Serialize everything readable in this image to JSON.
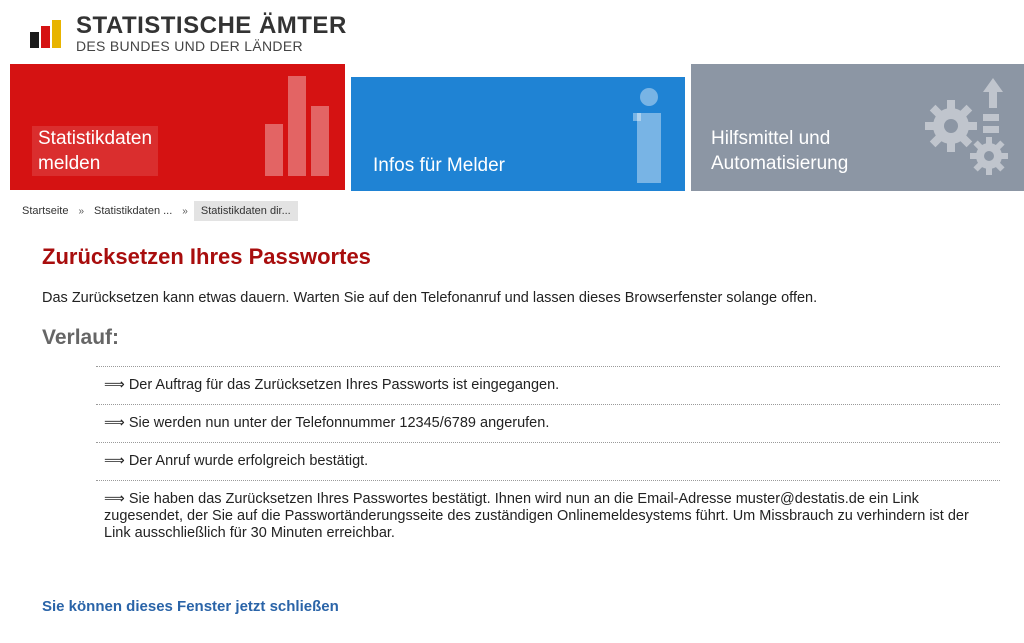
{
  "header": {
    "logo_title": "STATISTISCHE ÄMTER",
    "logo_subtitle": "DES BUNDES UND DER LÄNDER"
  },
  "tiles": [
    {
      "label": "Statistikdaten\nmelden",
      "color": "#d51212",
      "icon": "bar-chart-icon"
    },
    {
      "label": "Infos für Melder",
      "color": "#1f83d4",
      "icon": "info-icon"
    },
    {
      "label": "Hilfsmittel und\nAutomatisierung",
      "color": "#8c96a4",
      "icon": "gears-icon"
    }
  ],
  "breadcrumb": [
    {
      "label": "Startseite"
    },
    {
      "label": "Statistikdaten ..."
    },
    {
      "label": "Statistikdaten dir..."
    }
  ],
  "main": {
    "title": "Zurücksetzen Ihres Passwortes",
    "intro": "Das Zurücksetzen kann etwas dauern. Warten Sie auf den Telefonanruf und lassen dieses Browserfenster solange offen.",
    "history_heading": "Verlauf:",
    "steps": [
      "⟹ Der Auftrag für das Zurücksetzen Ihres Passworts ist eingegangen.",
      "⟹ Sie werden nun unter der Telefonnummer 12345/6789 angerufen.",
      "⟹ Der Anruf wurde erfolgreich bestätigt.",
      "⟹ Sie haben das Zurücksetzen Ihres Passwortes bestätigt. Ihnen wird nun an die Email-Adresse muster@destatis.de ein Link zugesendet, der Sie auf die Passwortänderungsseite des zuständigen Onlinemeldesystems führt. Um Missbrauch zu verhindern ist der Link ausschließlich für 30 Minuten erreichbar."
    ],
    "close_link": "Sie können dieses Fenster jetzt schließen"
  },
  "colors": {
    "title_red": "#a80d0d",
    "link_blue": "#2a64a8"
  }
}
